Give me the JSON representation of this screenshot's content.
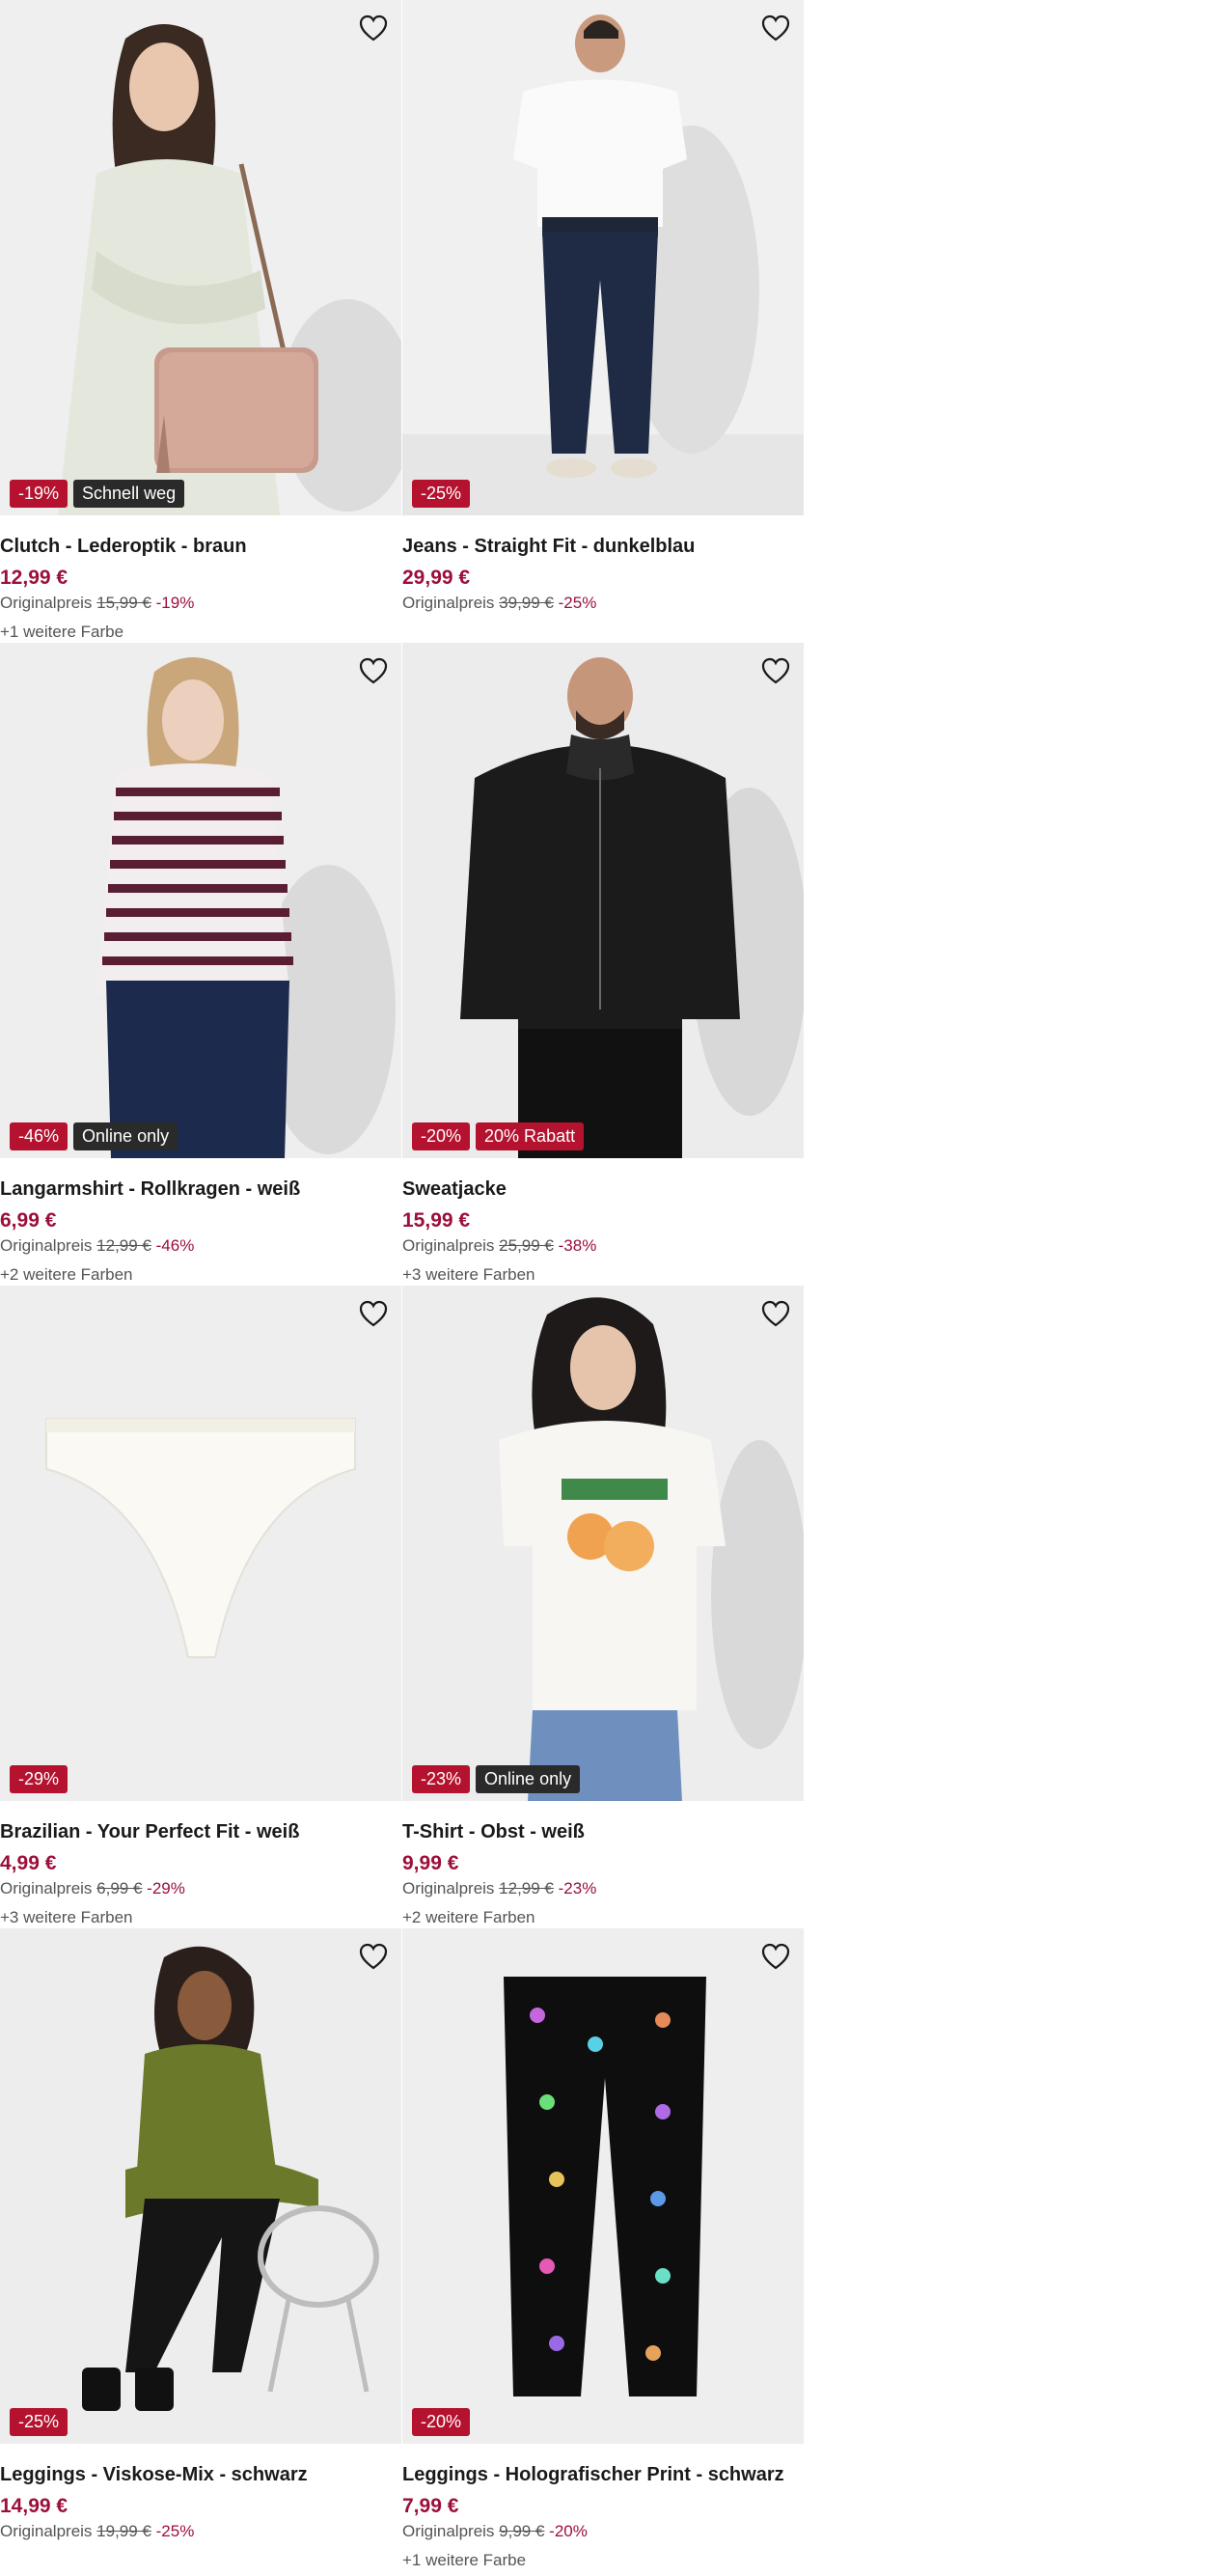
{
  "products": [
    {
      "title": "Clutch - Lederoptik - braun",
      "price": "12,99 €",
      "orig_label": "Originalpreis",
      "orig_price": "15,99 €",
      "discount": "-19%",
      "badges": [
        "-19%",
        "Schnell weg"
      ],
      "colors": "+1 weitere Farbe",
      "image": "woman-with-pink-bag"
    },
    {
      "title": "Jeans - Straight Fit - dunkelblau",
      "price": "29,99 €",
      "orig_label": "Originalpreis",
      "orig_price": "39,99 €",
      "discount": "-25%",
      "badges": [
        "-25%"
      ],
      "colors": "",
      "image": "man-in-jeans"
    },
    {
      "title": "Langarmshirt - Rollkragen - weiß",
      "price": "6,99 €",
      "orig_label": "Originalpreis",
      "orig_price": "12,99 €",
      "discount": "-46%",
      "badges": [
        "-46%",
        "Online only"
      ],
      "colors": "+2 weitere Farben",
      "image": "woman-striped-turtleneck"
    },
    {
      "title": "Sweatjacke",
      "price": "15,99 €",
      "orig_label": "Originalpreis",
      "orig_price": "25,99 €",
      "discount": "-38%",
      "badges": [
        "-20%",
        "20% Rabatt"
      ],
      "colors": "+3 weitere Farben",
      "image": "man-black-hoodie"
    },
    {
      "title": "Brazilian - Your Perfect Fit - weiß",
      "price": "4,99 €",
      "orig_label": "Originalpreis",
      "orig_price": "6,99 €",
      "discount": "-29%",
      "badges": [
        "-29%"
      ],
      "colors": "+3 weitere Farben",
      "image": "white-brazilian-brief"
    },
    {
      "title": "T-Shirt - Obst - weiß",
      "price": "9,99 €",
      "orig_label": "Originalpreis",
      "orig_price": "12,99 €",
      "discount": "-23%",
      "badges": [
        "-23%",
        "Online only"
      ],
      "colors": "+2 weitere Farben",
      "image": "woman-passion-tshirt"
    },
    {
      "title": "Leggings - Viskose-Mix - schwarz",
      "price": "14,99 €",
      "orig_label": "Originalpreis",
      "orig_price": "19,99 €",
      "discount": "-25%",
      "badges": [
        "-25%"
      ],
      "colors": "",
      "image": "woman-olive-top-on-chair"
    },
    {
      "title": "Leggings - Holografischer Print - schwarz",
      "price": "7,99 €",
      "orig_label": "Originalpreis",
      "orig_price": "9,99 €",
      "discount": "-20%",
      "badges": [
        "-20%"
      ],
      "colors": "+1 weitere Farbe",
      "image": "black-unicorn-leggings"
    }
  ],
  "theme": {
    "price_color": "#9c0f3a",
    "badge_red": "#b4122f",
    "badge_dark": "#2a2a2a",
    "image_bg": "#eeeeee"
  },
  "icons": {
    "wishlist": "heart-outline-icon"
  }
}
